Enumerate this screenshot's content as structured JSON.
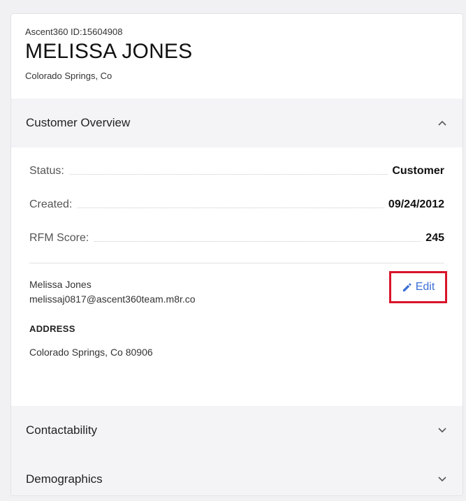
{
  "customer": {
    "id_line": "Ascent360 ID:15604908",
    "name": "MELISSA JONES",
    "location": "Colorado Springs, Co"
  },
  "sections": {
    "overview": {
      "title": "Customer Overview",
      "expanded": true,
      "icon": "chevron-up-icon"
    },
    "contactability": {
      "title": "Contactability",
      "expanded": false,
      "icon": "chevron-down-icon"
    },
    "demographics": {
      "title": "Demographics",
      "expanded": false,
      "icon": "chevron-down-icon"
    }
  },
  "overview": {
    "stats": [
      {
        "label": "Status:",
        "value": "Customer"
      },
      {
        "label": "Created:",
        "value": "09/24/2012"
      },
      {
        "label": "RFM Score:",
        "value": "245"
      }
    ],
    "contact": {
      "name": "Melissa Jones",
      "email": "melissaj0817@ascent360team.m8r.co",
      "edit_label": "Edit",
      "edit_icon": "pencil-icon"
    },
    "address": {
      "label": "ADDRESS",
      "value": "Colorado Springs, Co 80906"
    }
  },
  "colors": {
    "link": "#3b6fd6",
    "highlight_border": "#d8142a",
    "section_bg": "#f4f4f7"
  }
}
